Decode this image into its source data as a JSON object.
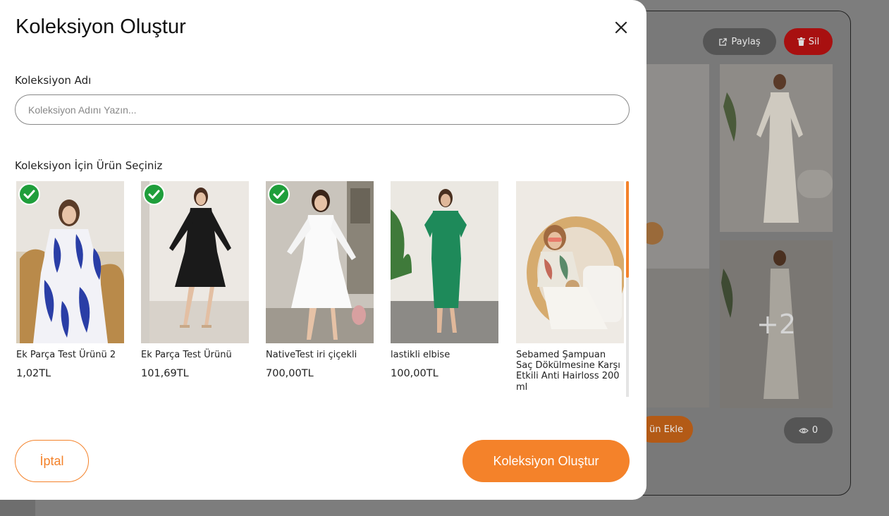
{
  "modal": {
    "title": "Koleksiyon Oluştur",
    "name_label": "Koleksiyon Adı",
    "name_placeholder": "Koleksiyon Adını Yazın...",
    "name_value": "",
    "products_label": "Koleksiyon İçin Ürün Seçiniz",
    "products": [
      {
        "name": "Ek Parça Test Ürünü 2",
        "price": "1,02TL",
        "selected": true
      },
      {
        "name": "Ek Parça Test Ürünü",
        "price": "101,69TL",
        "selected": true
      },
      {
        "name": "NativeTest iri çiçekli",
        "price": "700,00TL",
        "selected": true
      },
      {
        "name": "lastikli elbise",
        "price": "100,00TL",
        "selected": false
      },
      {
        "name": "Sebamed Şampuan Saç Dökülmesine Karşı Etkili Anti Hairloss 200 ml",
        "price": "",
        "selected": false
      }
    ],
    "cancel_label": "İptal",
    "create_label": "Koleksiyon Oluştur"
  },
  "background": {
    "share_label": "Paylaş",
    "delete_label": "Sil",
    "more_count": "+2",
    "add_label": "ün Ekle",
    "view_count": "0"
  },
  "colors": {
    "accent": "#f4822a",
    "check_green": "#1f9e3b",
    "delete_red": "#a81010"
  }
}
